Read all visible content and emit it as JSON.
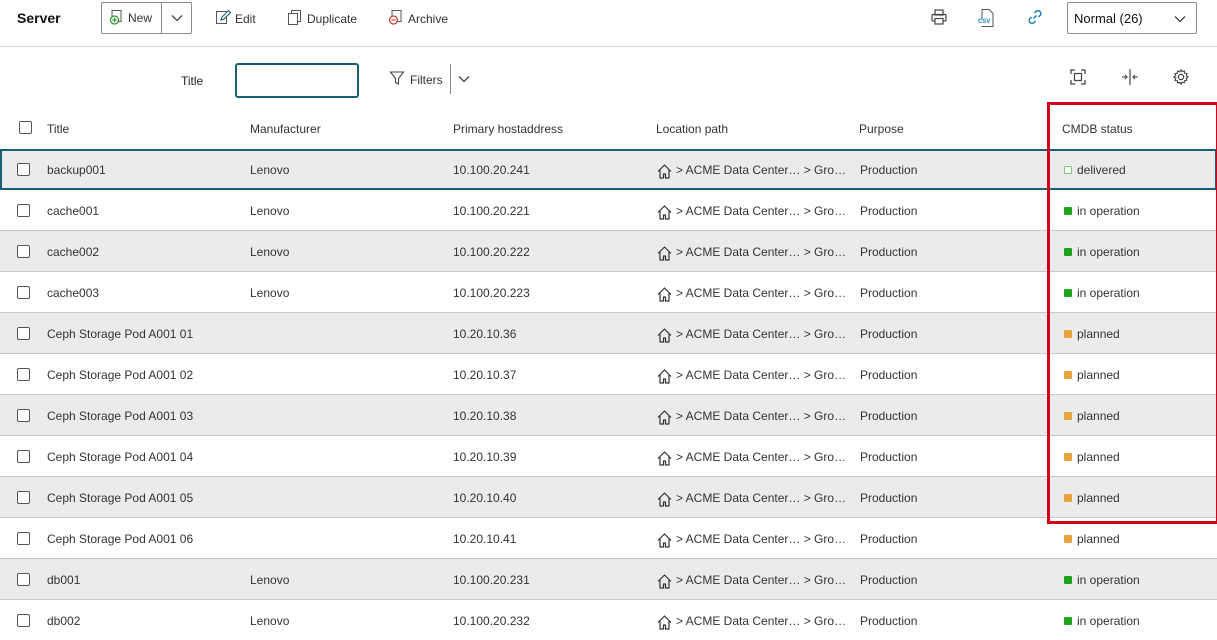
{
  "toolbar": {
    "title": "Server",
    "new_label": "New",
    "edit_label": "Edit",
    "duplicate_label": "Duplicate",
    "archive_label": "Archive",
    "view_select_value": "Normal (26)",
    "csv_badge": "CSV"
  },
  "filter": {
    "title_label": "Title",
    "title_value": "",
    "filters_label": "Filters"
  },
  "table": {
    "columns": [
      "Title",
      "Manufacturer",
      "Primary hostaddress",
      "Location path",
      "Purpose",
      "CMDB status"
    ],
    "rows": [
      {
        "title": "backup001",
        "manufacturer": "Lenovo",
        "host": "10.100.20.241",
        "location": "> ACME Data Center… > Gro…",
        "purpose": "Production",
        "status": "delivered"
      },
      {
        "title": "cache001",
        "manufacturer": "Lenovo",
        "host": "10.100.20.221",
        "location": "> ACME Data Center… > Gro…",
        "purpose": "Production",
        "status": "in operation"
      },
      {
        "title": "cache002",
        "manufacturer": "Lenovo",
        "host": "10.100.20.222",
        "location": "> ACME Data Center… > Gro…",
        "purpose": "Production",
        "status": "in operation"
      },
      {
        "title": "cache003",
        "manufacturer": "Lenovo",
        "host": "10.100.20.223",
        "location": "> ACME Data Center… > Gro…",
        "purpose": "Production",
        "status": "in operation"
      },
      {
        "title": "Ceph Storage Pod A001 01",
        "manufacturer": "",
        "host": "10.20.10.36",
        "location": "> ACME Data Center… > Gro…",
        "purpose": "Production",
        "status": "planned"
      },
      {
        "title": "Ceph Storage Pod A001 02",
        "manufacturer": "",
        "host": "10.20.10.37",
        "location": "> ACME Data Center… > Gro…",
        "purpose": "Production",
        "status": "planned"
      },
      {
        "title": "Ceph Storage Pod A001 03",
        "manufacturer": "",
        "host": "10.20.10.38",
        "location": "> ACME Data Center… > Gro…",
        "purpose": "Production",
        "status": "planned"
      },
      {
        "title": "Ceph Storage Pod A001 04",
        "manufacturer": "",
        "host": "10.20.10.39",
        "location": "> ACME Data Center… > Gro…",
        "purpose": "Production",
        "status": "planned"
      },
      {
        "title": "Ceph Storage Pod A001 05",
        "manufacturer": "",
        "host": "10.20.10.40",
        "location": "> ACME Data Center… > Gro…",
        "purpose": "Production",
        "status": "planned"
      },
      {
        "title": "Ceph Storage Pod A001 06",
        "manufacturer": "",
        "host": "10.20.10.41",
        "location": "> ACME Data Center… > Gro…",
        "purpose": "Production",
        "status": "planned"
      },
      {
        "title": "db001",
        "manufacturer": "Lenovo",
        "host": "10.100.20.231",
        "location": "> ACME Data Center… > Gro…",
        "purpose": "Production",
        "status": "in operation"
      },
      {
        "title": "db002",
        "manufacturer": "Lenovo",
        "host": "10.100.20.232",
        "location": "> ACME Data Center… > Gro…",
        "purpose": "Production",
        "status": "in operation"
      }
    ]
  },
  "colors": {
    "accent": "#1a5e78",
    "highlight": "#d0021b",
    "status_in_operation": "#1aa51a",
    "status_planned": "#e8a33c",
    "status_delivered": "#7ec97e",
    "row_alt": "#ebebeb"
  },
  "icons": {
    "new": "plus-circle-icon",
    "edit": "pencil-icon",
    "duplicate": "copy-icon",
    "archive": "minus-circle-icon",
    "print": "printer-icon",
    "csv": "csv-export-icon",
    "link": "link-icon",
    "filters": "funnel-icon",
    "fullscreen": "fullscreen-icon",
    "columns": "column-resize-icon",
    "settings": "gear-icon",
    "location": "home-icon"
  }
}
